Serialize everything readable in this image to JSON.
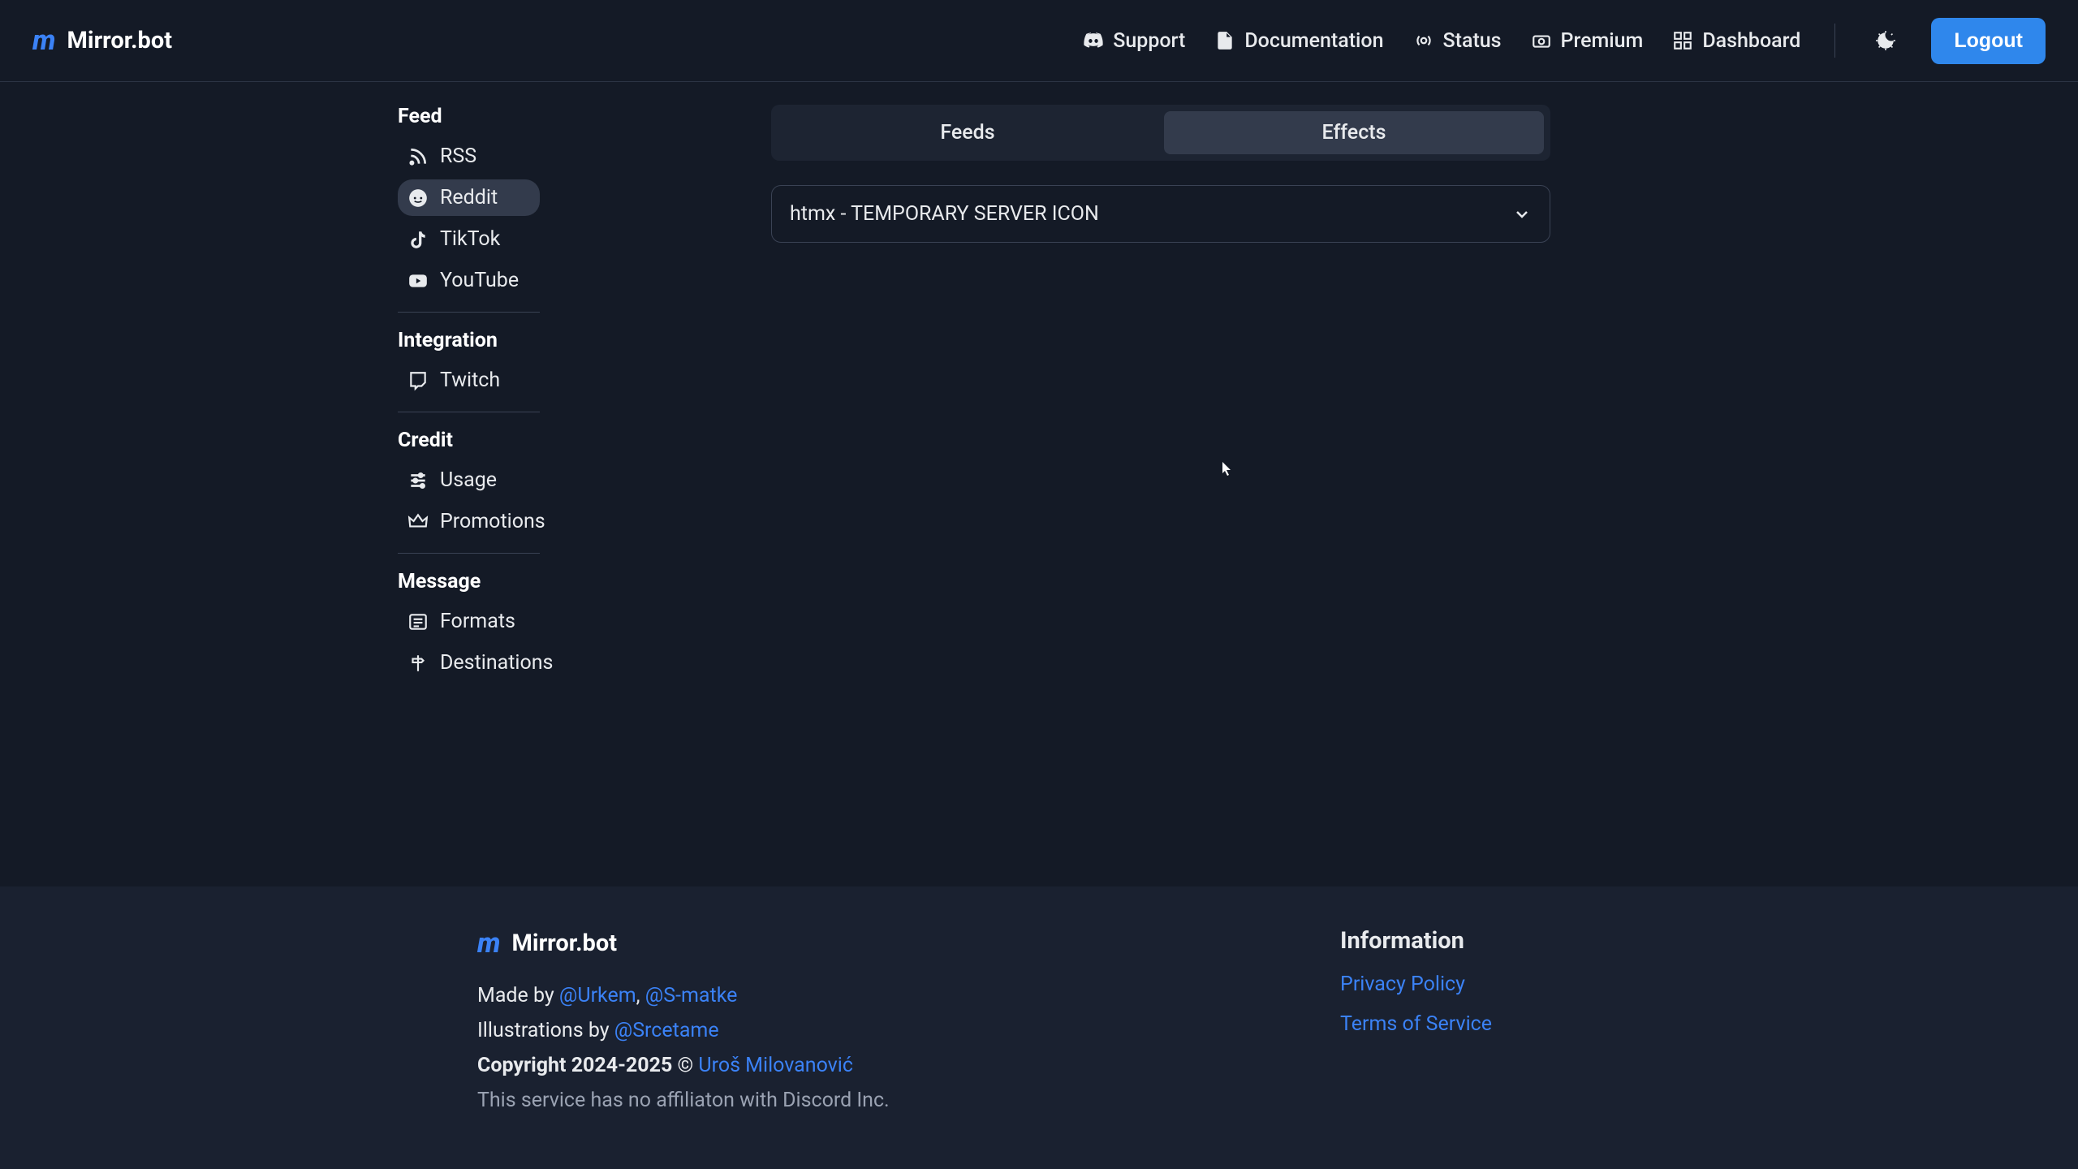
{
  "brand": {
    "name": "Mirror.bot"
  },
  "nav": {
    "support": "Support",
    "documentation": "Documentation",
    "status": "Status",
    "premium": "Premium",
    "dashboard": "Dashboard",
    "logout": "Logout"
  },
  "sidebar": {
    "sections": {
      "feed": {
        "title": "Feed",
        "items": [
          "RSS",
          "Reddit",
          "TikTok",
          "YouTube"
        ],
        "activeIndex": 1
      },
      "integration": {
        "title": "Integration",
        "items": [
          "Twitch"
        ]
      },
      "credit": {
        "title": "Credit",
        "items": [
          "Usage",
          "Promotions"
        ]
      },
      "message": {
        "title": "Message",
        "items": [
          "Formats",
          "Destinations"
        ]
      }
    }
  },
  "content": {
    "tabs": {
      "feeds": "Feeds",
      "effects": "Effects",
      "active": "effects"
    },
    "select": {
      "value": "htmx - TEMPORARY SERVER ICON"
    }
  },
  "footer": {
    "madeByPrefix": "Made by ",
    "madeByLinks": {
      "a": "@Urkem",
      "sep": ", ",
      "b": "@S-matke"
    },
    "illustrationsPrefix": "Illustrations by ",
    "illustrationsLink": "@Srcetame",
    "copyrightBold": "Copyright 2024-2025 ",
    "copyrightSymbol": "© ",
    "copyrightLink": "Uroš Milovanović",
    "affiliation": "This service has no affiliaton with Discord Inc.",
    "infoTitle": "Information",
    "privacy": "Privacy Policy",
    "tos": "Terms of Service"
  }
}
